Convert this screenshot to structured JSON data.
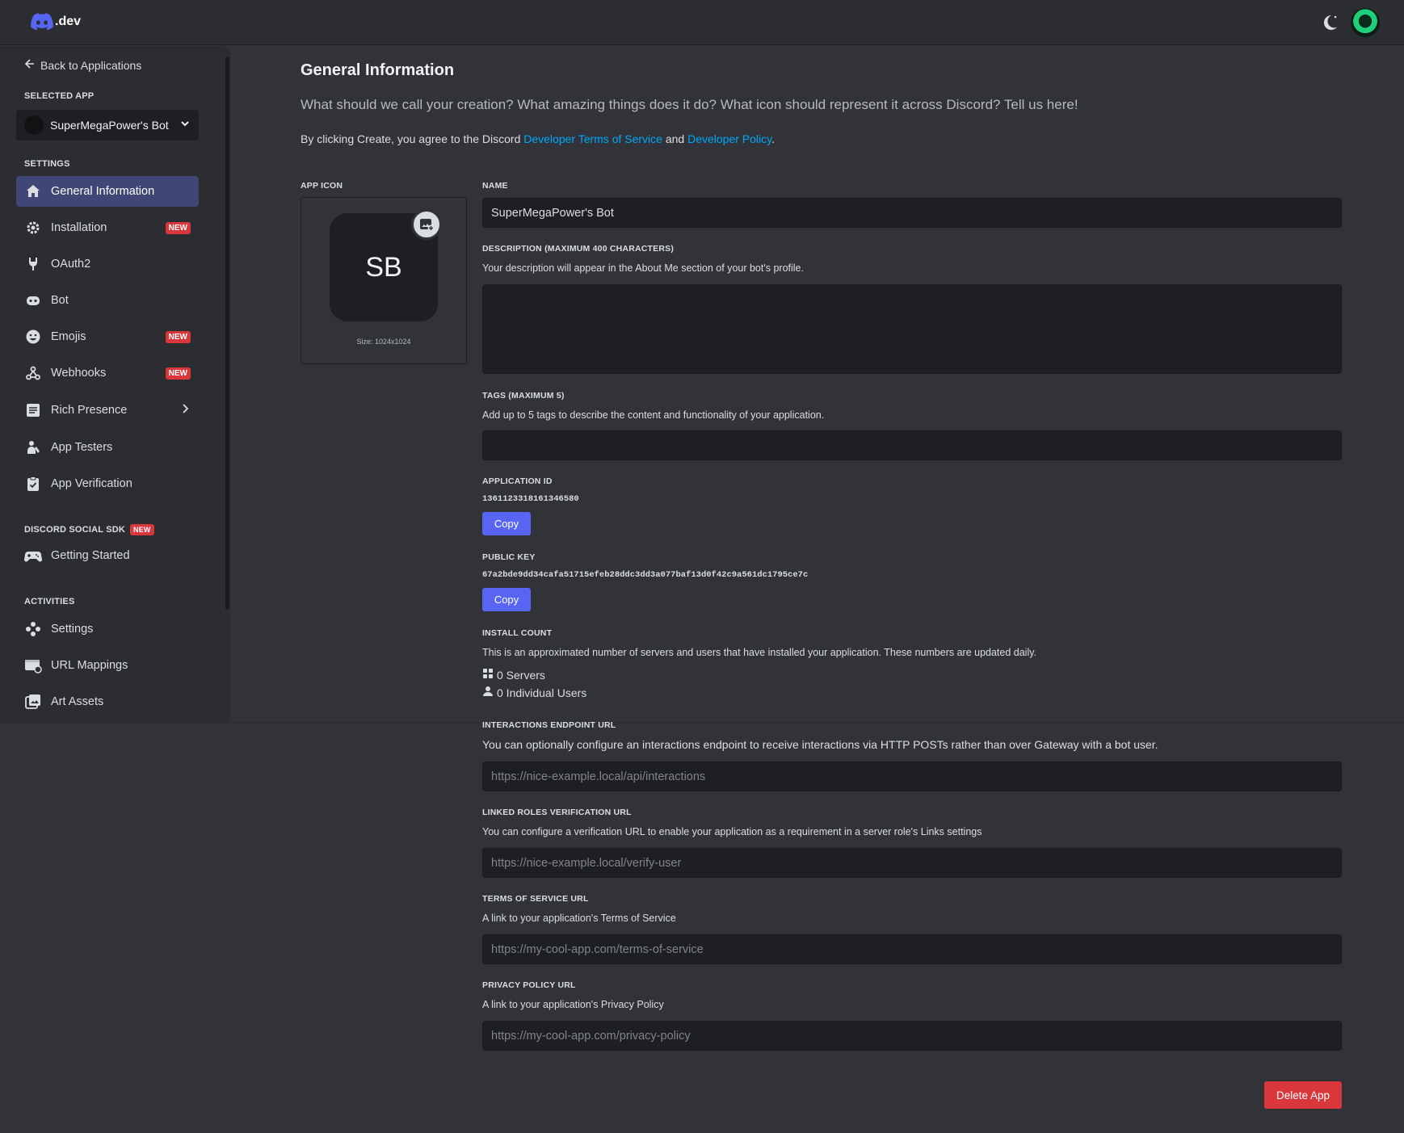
{
  "topbar": {
    "logo_text": ".dev",
    "theme_icon": "moon-icon",
    "avatar_icon": "avatar-icon"
  },
  "sidebar": {
    "back_label": "Back to Applications",
    "selected_app_label": "SELECTED APP",
    "selected_app_name": "SuperMegaPower's Bot",
    "settings_label": "SETTINGS",
    "settings_items": [
      {
        "label": "General Information",
        "icon": "home-icon"
      },
      {
        "label": "Installation",
        "icon": "gear-icon",
        "badge": "NEW"
      },
      {
        "label": "OAuth2",
        "icon": "wrench-icon"
      },
      {
        "label": "Bot",
        "icon": "robot-icon"
      },
      {
        "label": "Emojis",
        "icon": "smiley-icon",
        "badge": "NEW"
      },
      {
        "label": "Webhooks",
        "icon": "webhook-icon",
        "badge": "NEW"
      },
      {
        "label": "Rich Presence",
        "icon": "document-icon"
      },
      {
        "label": "App Testers",
        "icon": "person-icon"
      },
      {
        "label": "App Verification",
        "icon": "clipboard-check-icon"
      }
    ],
    "social_sdk_label": "DISCORD SOCIAL SDK",
    "social_sdk_badge": "NEW",
    "social_sdk_items": [
      {
        "label": "Getting Started",
        "icon": "gamepad-icon"
      }
    ],
    "activities_label": "ACTIVITIES",
    "activities_items": [
      {
        "label": "Settings",
        "icon": "activities-settings-icon"
      },
      {
        "label": "URL Mappings",
        "icon": "url-mappings-icon"
      },
      {
        "label": "Art Assets",
        "icon": "art-assets-icon"
      }
    ]
  },
  "main": {
    "title": "General Information",
    "subtitle": "What should we call your creation? What amazing things does it do? What icon should represent it across Discord? Tell us here!",
    "terms_prefix": "By clicking Create, you agree to the Discord",
    "terms_link": "Developer Terms of Service",
    "terms_and": "and",
    "policy_link": "Developer Policy",
    "terms_suffix": ".",
    "app_icon": {
      "label": "APP ICON",
      "initials": "SB",
      "size_note": "Size: 1024x1024"
    },
    "name": {
      "label": "NAME",
      "value": "SuperMegaPower's Bot"
    },
    "description": {
      "label": "DESCRIPTION (MAXIMUM 400 CHARACTERS)",
      "help": "Your description will appear in the About Me section of your bot's profile.",
      "value": ""
    },
    "tags": {
      "label": "TAGS (MAXIMUM 5)",
      "help": "Add up to 5 tags to describe the content and functionality of your application.",
      "value": ""
    },
    "application_id": {
      "label": "APPLICATION ID",
      "value": "1361123318161346580",
      "copy": "Copy"
    },
    "public_key": {
      "label": "PUBLIC KEY",
      "value": "67a2bde9dd34cafa51715efeb28ddc3dd3a077baf13d0f42c9a561dc1795ce7c",
      "copy": "Copy"
    },
    "install_count": {
      "label": "INSTALL COUNT",
      "help": "This is an approximated number of servers and users that have installed your application. These numbers are updated daily.",
      "servers": "0 Servers",
      "users": "0 Individual Users"
    },
    "interactions": {
      "label": "INTERACTIONS ENDPOINT URL",
      "help": "You can optionally configure an interactions endpoint to receive interactions via HTTP POSTs rather than over Gateway with a bot user.",
      "placeholder": "https://nice-example.local/api/interactions"
    },
    "linked_roles": {
      "label": "LINKED ROLES VERIFICATION URL",
      "help": "You can configure a verification URL to enable your application as a requirement in a server role's Links settings",
      "placeholder": "https://nice-example.local/verify-user"
    },
    "tos": {
      "label": "TERMS OF SERVICE URL",
      "help": "A link to your application's Terms of Service",
      "placeholder": "https://my-cool-app.com/terms-of-service"
    },
    "privacy": {
      "label": "PRIVACY POLICY URL",
      "help": "A link to your application's Privacy Policy",
      "placeholder": "https://my-cool-app.com/privacy-policy"
    },
    "delete_button": "Delete App"
  },
  "colors": {
    "accent": "#5865f2",
    "danger": "#da373c",
    "link": "#00a8fc",
    "active_nav": "#404675"
  }
}
